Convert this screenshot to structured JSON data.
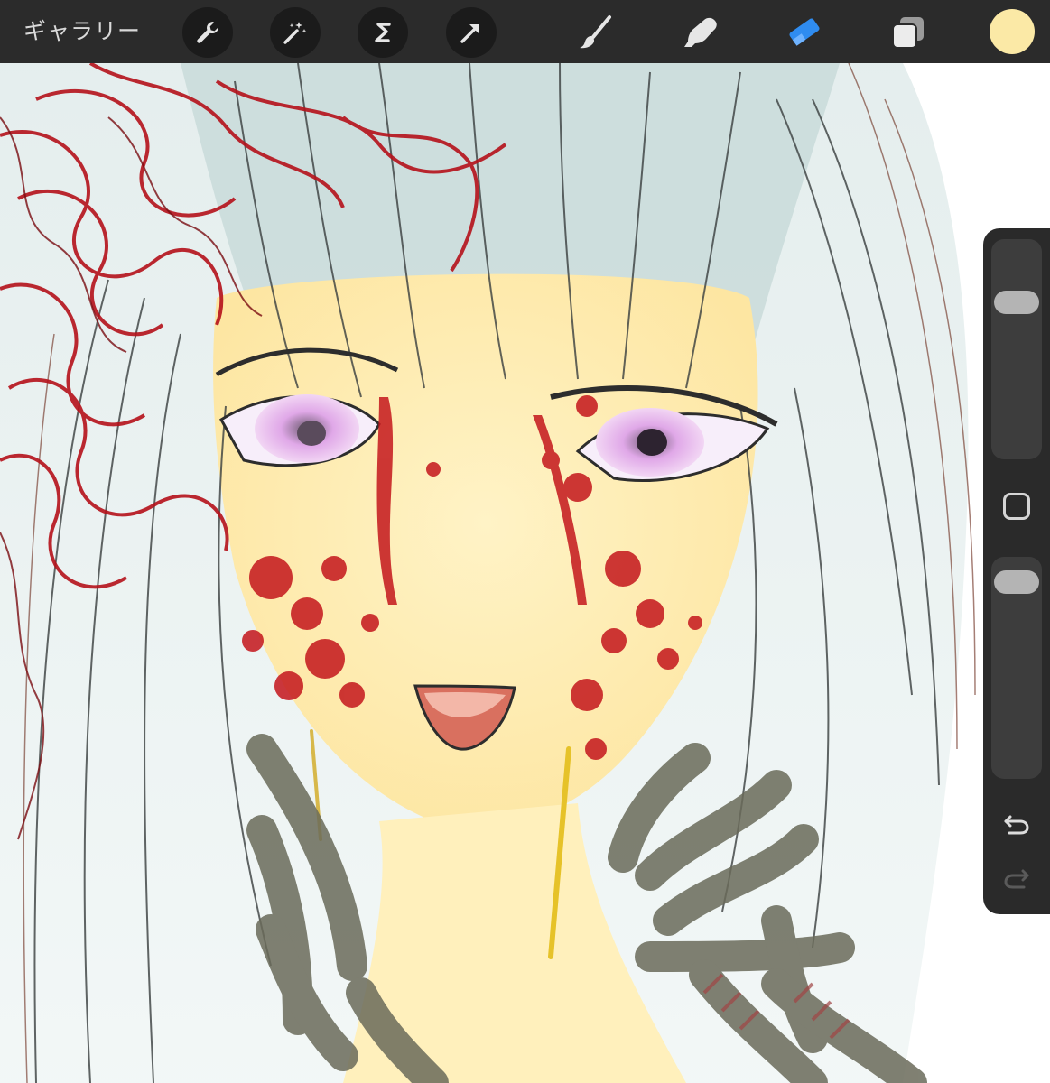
{
  "toolbar": {
    "gallery_label": "ギャラリー",
    "actions_icon": "wrench-icon",
    "adjustments_icon": "magic-wand-icon",
    "selection_icon": "selection-s-icon",
    "transform_icon": "arrow-cursor-icon",
    "brush_icon": "paintbrush-icon",
    "smudge_icon": "smudge-finger-icon",
    "eraser_icon": "eraser-icon",
    "layers_icon": "layers-icon",
    "active_tool": "eraser",
    "active_color": "#fbe9a6",
    "accent_color": "#2f8cf0"
  },
  "sidebar": {
    "brush_size_level": 0.75,
    "opacity_level": 0.95,
    "modify_icon": "square-icon",
    "undo_icon": "undo-arrow-icon",
    "redo_icon": "redo-arrow-icon"
  },
  "canvas": {
    "subject": "illustration-canvas"
  }
}
